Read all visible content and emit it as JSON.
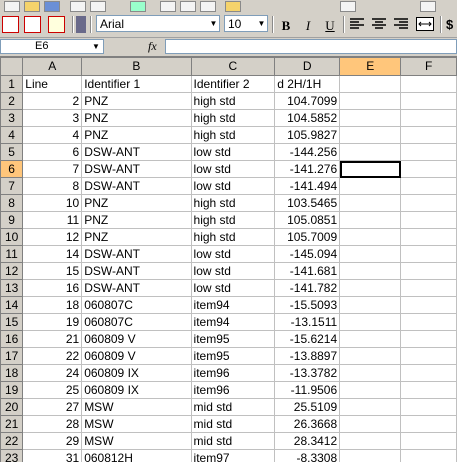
{
  "format_toolbar": {
    "font_name": "Arial",
    "font_size": "10",
    "bold_label": "B",
    "italic_label": "I",
    "underline_label": "U"
  },
  "formula_bar": {
    "name_box": "E6",
    "fx_label": "fx",
    "formula": ""
  },
  "grid": {
    "columns": [
      "A",
      "B",
      "C",
      "D",
      "E",
      "F"
    ],
    "active_cell": "E6",
    "rows": [
      {
        "n": "1",
        "a": "Line",
        "b": "Identifier 1",
        "c": "Identifier 2",
        "d": "d 2H/1H"
      },
      {
        "n": "2",
        "a": "2",
        "b": "PNZ",
        "c": "high std",
        "d": "104.7099"
      },
      {
        "n": "3",
        "a": "3",
        "b": "PNZ",
        "c": "high std",
        "d": "104.5852"
      },
      {
        "n": "4",
        "a": "4",
        "b": "PNZ",
        "c": "high std",
        "d": "105.9827"
      },
      {
        "n": "5",
        "a": "6",
        "b": "DSW-ANT",
        "c": "low std",
        "d": "-144.256"
      },
      {
        "n": "6",
        "a": "7",
        "b": "DSW-ANT",
        "c": "low std",
        "d": "-141.276"
      },
      {
        "n": "7",
        "a": "8",
        "b": "DSW-ANT",
        "c": "low std",
        "d": "-141.494"
      },
      {
        "n": "8",
        "a": "10",
        "b": "PNZ",
        "c": "high std",
        "d": "103.5465"
      },
      {
        "n": "9",
        "a": "11",
        "b": "PNZ",
        "c": "high std",
        "d": "105.0851"
      },
      {
        "n": "10",
        "a": "12",
        "b": "PNZ",
        "c": "high std",
        "d": "105.7009"
      },
      {
        "n": "11",
        "a": "14",
        "b": "DSW-ANT",
        "c": "low std",
        "d": "-145.094"
      },
      {
        "n": "12",
        "a": "15",
        "b": "DSW-ANT",
        "c": "low std",
        "d": "-141.681"
      },
      {
        "n": "13",
        "a": "16",
        "b": "DSW-ANT",
        "c": "low std",
        "d": "-141.782"
      },
      {
        "n": "14",
        "a": "18",
        "b": "060807C",
        "c": "item94",
        "d": "-15.5093"
      },
      {
        "n": "15",
        "a": "19",
        "b": "060807C",
        "c": "item94",
        "d": "-13.1511"
      },
      {
        "n": "16",
        "a": "21",
        "b": "060809 V",
        "c": "item95",
        "d": "-15.6214"
      },
      {
        "n": "17",
        "a": "22",
        "b": "060809 V",
        "c": "item95",
        "d": "-13.8897"
      },
      {
        "n": "18",
        "a": "24",
        "b": "060809 IX",
        "c": "item96",
        "d": "-13.3782"
      },
      {
        "n": "19",
        "a": "25",
        "b": "060809 IX",
        "c": "item96",
        "d": "-11.9506"
      },
      {
        "n": "20",
        "a": "27",
        "b": "MSW",
        "c": "mid std",
        "d": "25.5109"
      },
      {
        "n": "21",
        "a": "28",
        "b": "MSW",
        "c": "mid std",
        "d": "26.3668"
      },
      {
        "n": "22",
        "a": "29",
        "b": "MSW",
        "c": "mid std",
        "d": "28.3412"
      },
      {
        "n": "23",
        "a": "31",
        "b": "060812H",
        "c": "item97",
        "d": "-8.3308"
      }
    ]
  }
}
